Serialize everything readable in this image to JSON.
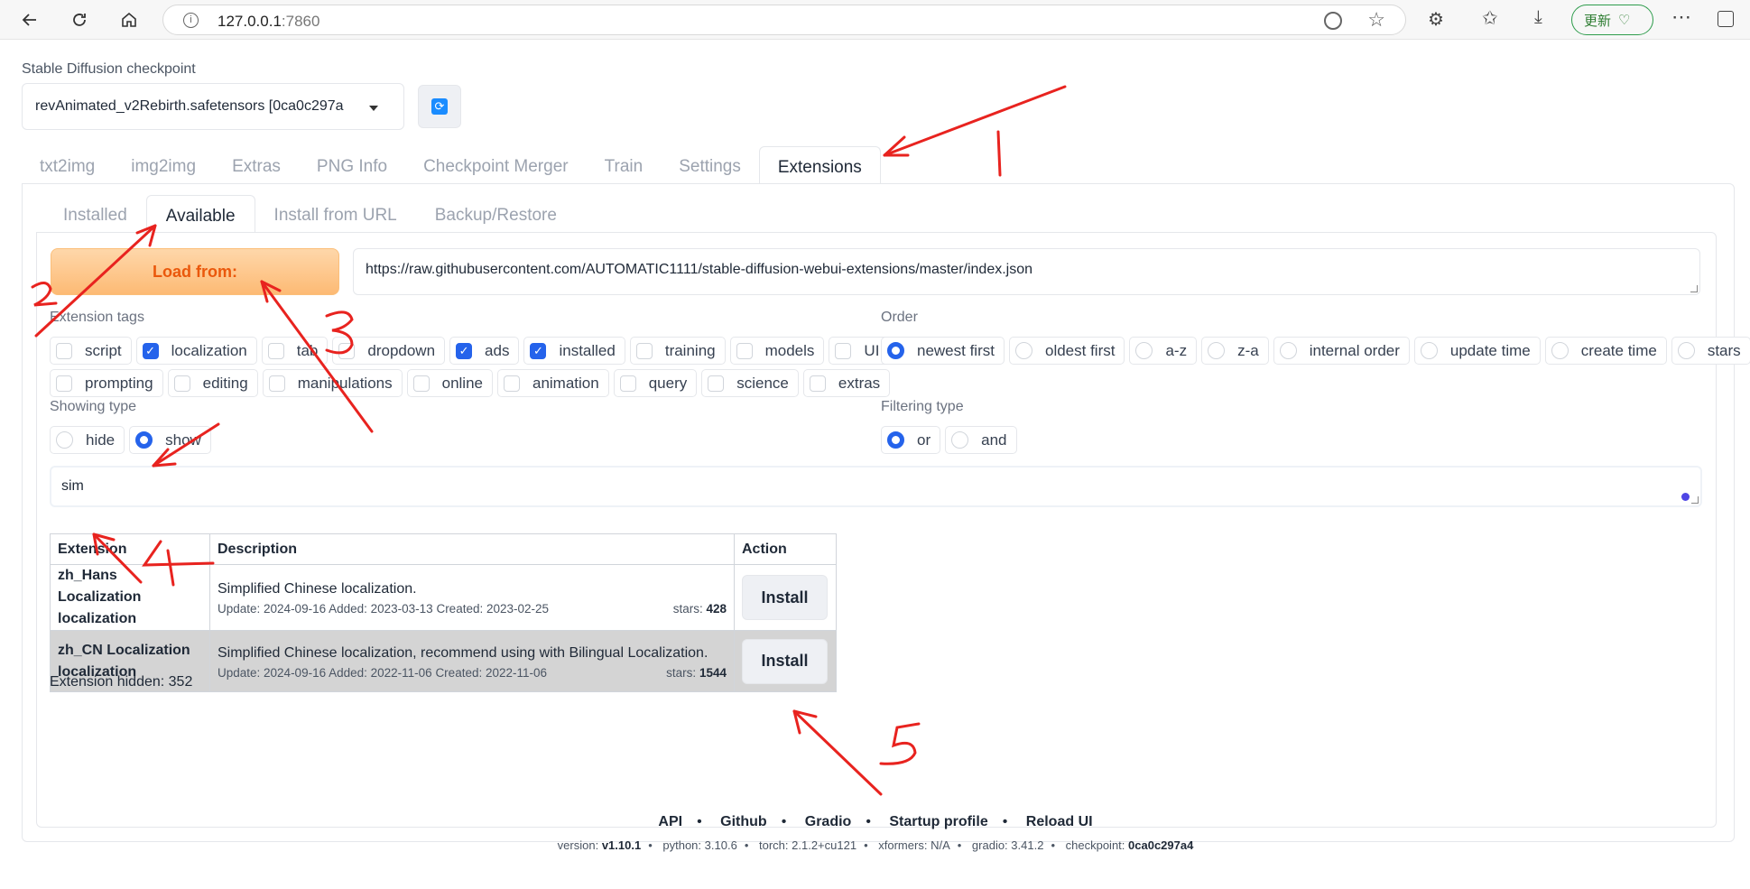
{
  "browser": {
    "url_host": "127.0.0.1",
    "url_port": ":7860",
    "update_label": "更新"
  },
  "checkpoint": {
    "label": "Stable Diffusion checkpoint",
    "value": "revAnimated_v2Rebirth.safetensors [0ca0c297a"
  },
  "main_tabs": [
    "txt2img",
    "img2img",
    "Extras",
    "PNG Info",
    "Checkpoint Merger",
    "Train",
    "Settings",
    "Extensions"
  ],
  "sub_tabs": [
    "Installed",
    "Available",
    "Install from URL",
    "Backup/Restore"
  ],
  "load_button": "Load from:",
  "index_url": "https://raw.githubusercontent.com/AUTOMATIC1111/stable-diffusion-webui-extensions/master/index.json",
  "extension_tags": {
    "label": "Extension tags",
    "row1": [
      {
        "label": "script",
        "checked": false
      },
      {
        "label": "localization",
        "checked": true
      },
      {
        "label": "tab",
        "checked": false
      },
      {
        "label": "dropdown",
        "checked": false
      },
      {
        "label": "ads",
        "checked": true
      },
      {
        "label": "installed",
        "checked": true
      },
      {
        "label": "training",
        "checked": false
      },
      {
        "label": "models",
        "checked": false
      },
      {
        "label": "UI related",
        "checked": false
      }
    ],
    "row2": [
      {
        "label": "prompting",
        "checked": false
      },
      {
        "label": "editing",
        "checked": false
      },
      {
        "label": "manipulations",
        "checked": false
      },
      {
        "label": "online",
        "checked": false
      },
      {
        "label": "animation",
        "checked": false
      },
      {
        "label": "query",
        "checked": false
      },
      {
        "label": "science",
        "checked": false
      },
      {
        "label": "extras",
        "checked": false
      }
    ]
  },
  "order": {
    "label": "Order",
    "options": [
      {
        "label": "newest first",
        "selected": true
      },
      {
        "label": "oldest first",
        "selected": false
      },
      {
        "label": "a-z",
        "selected": false
      },
      {
        "label": "z-a",
        "selected": false
      },
      {
        "label": "internal order",
        "selected": false
      },
      {
        "label": "update time",
        "selected": false
      },
      {
        "label": "create time",
        "selected": false
      },
      {
        "label": "stars",
        "selected": false
      }
    ]
  },
  "showing_type": {
    "label": "Showing type",
    "options": [
      {
        "label": "hide",
        "selected": false
      },
      {
        "label": "show",
        "selected": true
      }
    ]
  },
  "filtering_type": {
    "label": "Filtering type",
    "options": [
      {
        "label": "or",
        "selected": true
      },
      {
        "label": "and",
        "selected": false
      }
    ]
  },
  "search_value": "sim",
  "table": {
    "headers": [
      "Extension",
      "Description",
      "Action"
    ],
    "rows": [
      {
        "name_line1": "zh_Hans Localization",
        "name_line2": "localization",
        "description": "Simplified Chinese localization.",
        "dates": "Update: 2024-09-16 Added: 2023-03-13 Created: 2023-02-25",
        "stars_label": "stars:",
        "stars": "428",
        "action": "Install"
      },
      {
        "name_line1": "zh_CN Localization",
        "name_line2": "localization",
        "description": "Simplified Chinese localization, recommend using with Bilingual Localization.",
        "dates": "Update: 2024-09-16 Added: 2022-11-06 Created: 2022-11-06",
        "stars_label": "stars:",
        "stars": "1544",
        "action": "Install"
      }
    ]
  },
  "hidden_count": "Extension hidden: 352",
  "footer": {
    "links": [
      "API",
      "Github",
      "Gradio",
      "Startup profile",
      "Reload UI"
    ],
    "version_items": [
      {
        "key": "version:",
        "value": "v1.10.1"
      },
      {
        "key": "python:",
        "value": "3.10.6"
      },
      {
        "key": "torch:",
        "value": "2.1.2+cu121"
      },
      {
        "key": "xformers:",
        "value": "N/A"
      },
      {
        "key": "gradio:",
        "value": "3.41.2"
      },
      {
        "key": "checkpoint:",
        "value": "0ca0c297a4"
      }
    ]
  },
  "annotations": {
    "color": "#e8231f",
    "numbers": [
      "1",
      "2",
      "3",
      "4",
      "5"
    ]
  }
}
